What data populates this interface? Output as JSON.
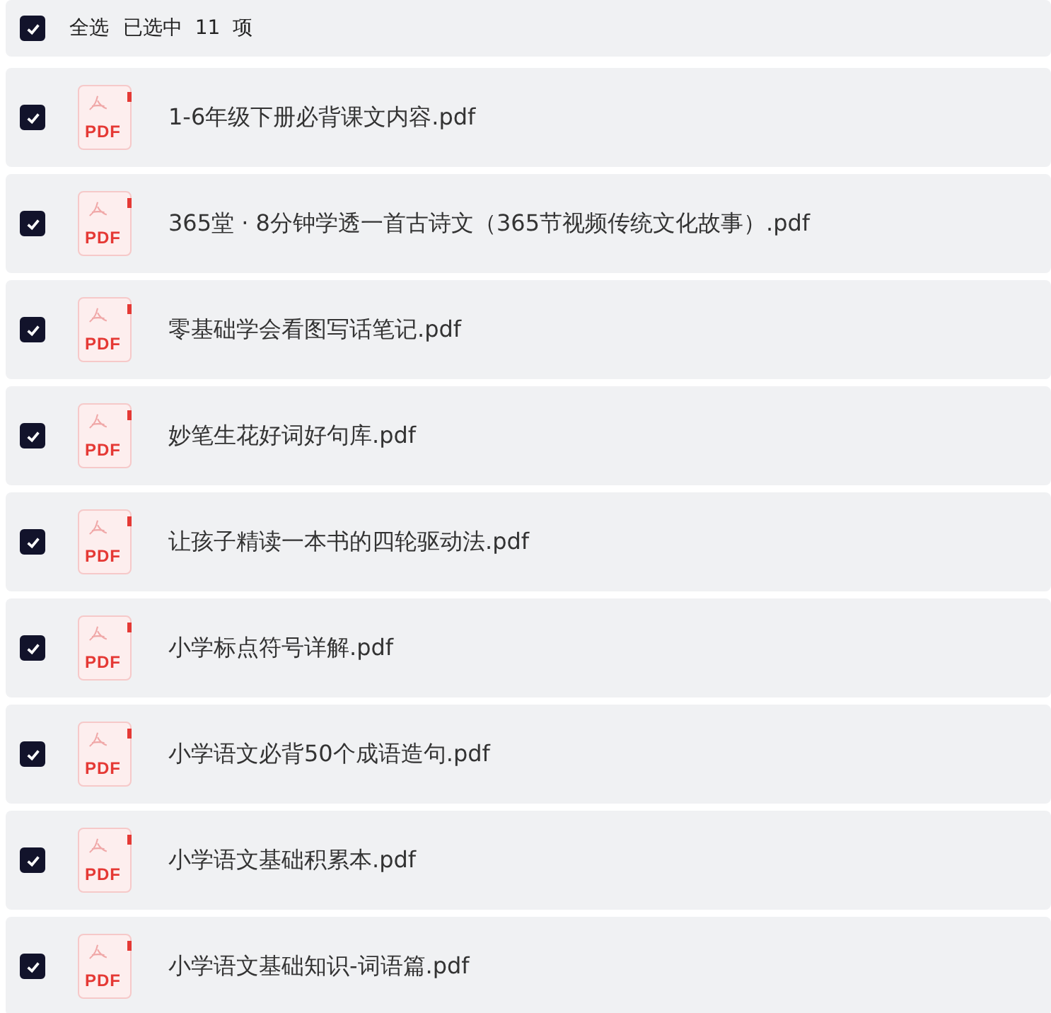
{
  "header": {
    "select_all": {
      "label": "全选",
      "checked": true
    },
    "selection_summary": "已选中  11  项"
  },
  "files": [
    {
      "name": "1-6年级下册必背课文内容.pdf",
      "icon_label": "PDF",
      "checked": true
    },
    {
      "name": "365堂 · 8分钟学透一首古诗文（365节视频传统文化故事）.pdf",
      "icon_label": "PDF",
      "checked": true
    },
    {
      "name": "零基础学会看图写话笔记.pdf",
      "icon_label": "PDF",
      "checked": true
    },
    {
      "name": "妙笔生花好词好句库.pdf",
      "icon_label": "PDF",
      "checked": true
    },
    {
      "name": "让孩子精读一本书的四轮驱动法.pdf",
      "icon_label": "PDF",
      "checked": true
    },
    {
      "name": "小学标点符号详解.pdf",
      "icon_label": "PDF",
      "checked": true
    },
    {
      "name": "小学语文必背50个成语造句.pdf",
      "icon_label": "PDF",
      "checked": true
    },
    {
      "name": "小学语文基础积累本.pdf",
      "icon_label": "PDF",
      "checked": true
    },
    {
      "name": "小学语文基础知识-词语篇.pdf",
      "icon_label": "PDF",
      "checked": true
    }
  ]
}
